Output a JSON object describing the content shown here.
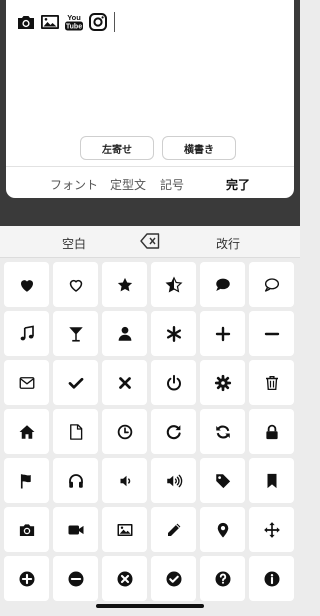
{
  "editor": {
    "inserted_icons": [
      "camera-icon",
      "picture-icon",
      "youtube-icon",
      "instagram-icon"
    ],
    "youtube_text_top": "You",
    "youtube_text_bottom": "Tube",
    "align_left_label": "左寄せ",
    "vertical_label": "横書き"
  },
  "tabs": {
    "font": "フォント",
    "template": "定型文",
    "symbol": "記号",
    "done": "完了"
  },
  "keyboard": {
    "space": "空白",
    "backspace_icon": "backspace-icon",
    "newline": "改行"
  },
  "icon_grid": [
    "heart-icon",
    "heart-outline-icon",
    "star-icon",
    "star-half-icon",
    "speech-bubble-icon",
    "speech-bubble-outline-icon",
    "music-note-icon",
    "cocktail-icon",
    "user-icon",
    "asterisk-icon",
    "plus-icon",
    "minus-icon",
    "envelope-icon",
    "checkmark-icon",
    "close-x-icon",
    "power-icon",
    "gear-icon",
    "trash-icon",
    "home-icon",
    "document-icon",
    "clock-icon",
    "redo-icon",
    "refresh-icon",
    "lock-icon",
    "flag-icon",
    "headphones-icon",
    "volume-low-icon",
    "volume-high-icon",
    "tag-icon",
    "bookmark-icon",
    "camera-icon",
    "video-camera-icon",
    "picture-icon",
    "pencil-icon",
    "map-marker-icon",
    "move-arrows-icon",
    "plus-circle-icon",
    "minus-circle-icon",
    "x-circle-icon",
    "check-circle-icon",
    "question-circle-icon",
    "info-circle-icon"
  ]
}
